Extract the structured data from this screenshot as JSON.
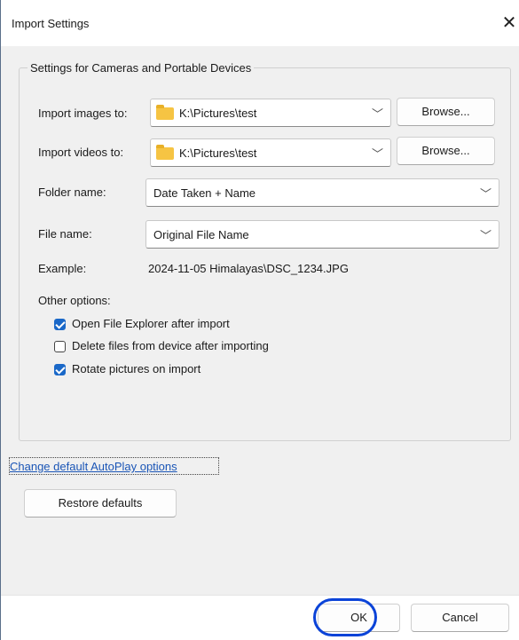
{
  "window": {
    "title": "Import Settings",
    "close_icon": "close-icon"
  },
  "group": {
    "legend": "Settings for Cameras and Portable Devices",
    "import_images_label": "Import images to:",
    "import_images_value": "K:\\Pictures\\test",
    "import_videos_label": "Import videos to:",
    "import_videos_value": "K:\\Pictures\\test",
    "browse_label": "Browse...",
    "folder_name_label": "Folder name:",
    "folder_name_value": "Date Taken + Name",
    "file_name_label": "File name:",
    "file_name_value": "Original File Name",
    "example_label": "Example:",
    "example_value": "2024-11-05 Himalayas\\DSC_1234.JPG",
    "other_options_label": "Other options:",
    "options": [
      {
        "label": "Open File Explorer after import",
        "checked": true
      },
      {
        "label": "Delete files from device after importing",
        "checked": false
      },
      {
        "label": "Rotate pictures on import",
        "checked": true
      }
    ]
  },
  "autoplay_link": "Change default AutoPlay options",
  "restore_defaults": "Restore defaults",
  "footer": {
    "ok": "OK",
    "cancel": "Cancel"
  },
  "colors": {
    "accent": "#1a68c8",
    "highlight_circle": "#0b43d8",
    "link": "#1a55b6"
  }
}
